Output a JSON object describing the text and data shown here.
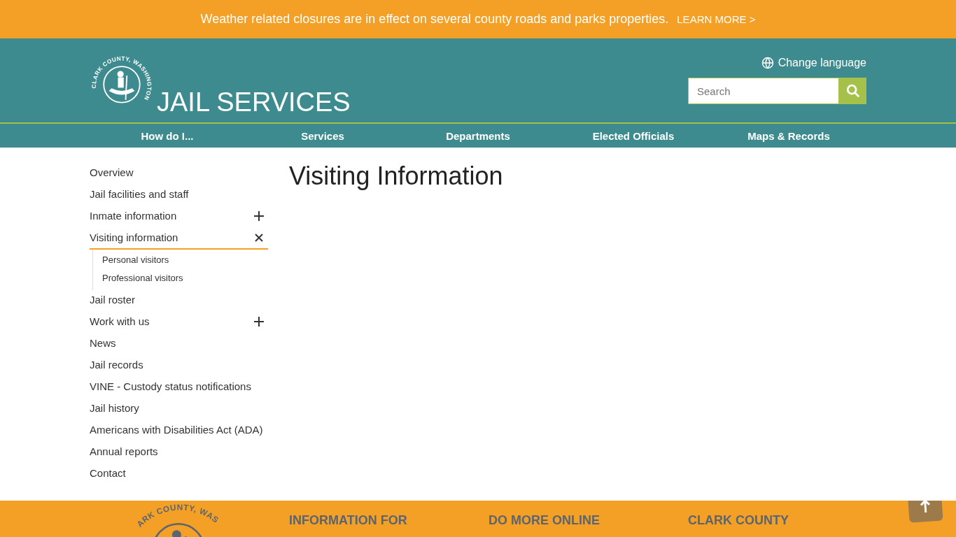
{
  "alert": {
    "message": "Weather related closures are in effect on several county roads and parks properties.",
    "link": "LEARN MORE >"
  },
  "header": {
    "logo_text": "CLARK COUNTY, WASHINGTON",
    "site_title": "JAIL SERVICES",
    "language_link": "Change language",
    "search": {
      "placeholder": "Search"
    }
  },
  "nav": [
    {
      "label": "How do I..."
    },
    {
      "label": "Services"
    },
    {
      "label": "Departments"
    },
    {
      "label": "Elected Officials"
    },
    {
      "label": "Maps & Records"
    }
  ],
  "sidebar": {
    "items": [
      {
        "label": "Overview",
        "selected": false
      },
      {
        "label": "Jail facilities and staff",
        "selected": false
      },
      {
        "label": "Inmate information",
        "selected": false,
        "expanded": false
      },
      {
        "label": "Visiting information",
        "selected": true,
        "expanded": true,
        "children": [
          {
            "label": "Personal visitors"
          },
          {
            "label": "Professional visitors"
          }
        ]
      },
      {
        "label": "Jail roster",
        "selected": false
      },
      {
        "label": "Work with us",
        "selected": false,
        "expanded": false
      },
      {
        "label": "News",
        "selected": false
      },
      {
        "label": "Jail records",
        "selected": false
      },
      {
        "label": "VINE - Custody status notifications",
        "selected": false
      },
      {
        "label": "Jail history",
        "selected": false
      },
      {
        "label": "Americans with Disabilities Act (ADA)",
        "selected": false
      },
      {
        "label": "Annual reports",
        "selected": false
      },
      {
        "label": "Contact",
        "selected": false
      }
    ]
  },
  "main": {
    "title": "Visiting Information"
  },
  "footer": {
    "logo_text": "ARK COUNTY, WAS",
    "headings": [
      "INFORMATION FOR",
      "DO MORE ONLINE",
      "CLARK COUNTY"
    ]
  }
}
